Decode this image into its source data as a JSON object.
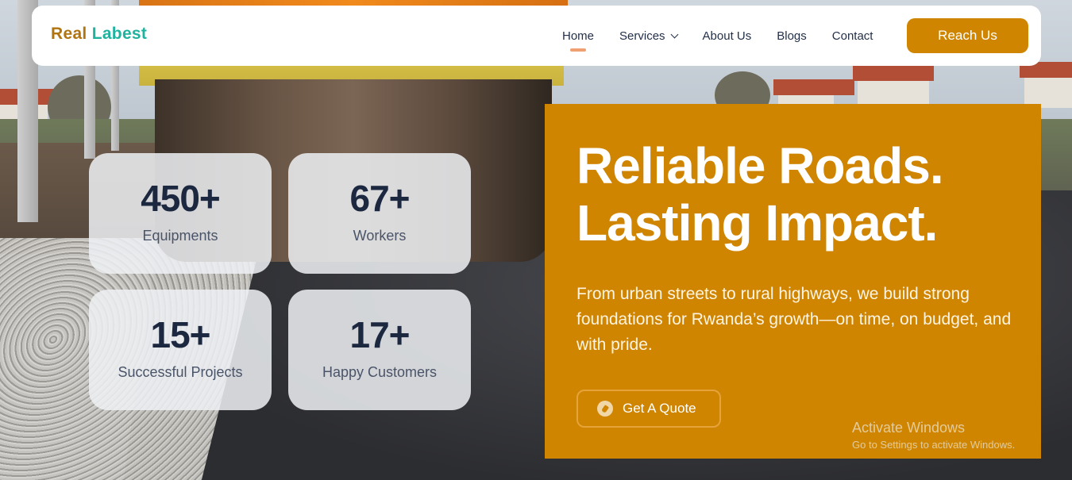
{
  "brand": {
    "part1": "Real",
    "part2": "Labest"
  },
  "nav": {
    "items": [
      {
        "label": "Home",
        "active": true
      },
      {
        "label": "Services",
        "dropdown": true
      },
      {
        "label": "About Us"
      },
      {
        "label": "Blogs"
      },
      {
        "label": "Contact"
      }
    ],
    "cta_label": "Reach Us"
  },
  "stats": [
    {
      "value": "450+",
      "label": "Equipments"
    },
    {
      "value": "67+",
      "label": "Workers"
    },
    {
      "value": "15+",
      "label": "Successful Projects"
    },
    {
      "value": "17+",
      "label": "Happy Customers"
    }
  ],
  "hero": {
    "title_line1": "Reliable Roads.",
    "title_line2": "Lasting Impact.",
    "description": "From urban streets to rural highways, we build strong foundations for Rwanda’s growth—on time, on budget, and with pride.",
    "button_label": "Get A Quote",
    "button_icon": "compass-icon"
  },
  "watermark": {
    "line1": "Activate Windows",
    "line2": "Go to Settings to activate Windows."
  },
  "colors": {
    "accent": "#cf8500",
    "logo_primary": "#b07410",
    "logo_secondary": "#1fb39f",
    "nav_text": "#243049",
    "active_indicator": "#f0a070"
  }
}
